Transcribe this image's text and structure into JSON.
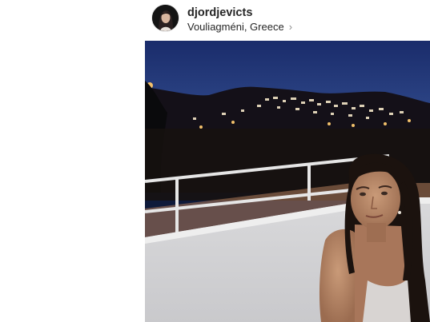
{
  "post": {
    "username": "djordjevicts",
    "location": "Vouliagméni, Greece",
    "location_chevron": "›",
    "avatar": "profile-avatar-woman-dark-hair",
    "photo": "night-balcony-photo-woman-over-town-lights"
  },
  "colors": {
    "text_primary": "#262626",
    "text_secondary": "#8e8e8e",
    "sky_top": "#1a2c6b",
    "sky_bottom": "#2f4d93"
  }
}
